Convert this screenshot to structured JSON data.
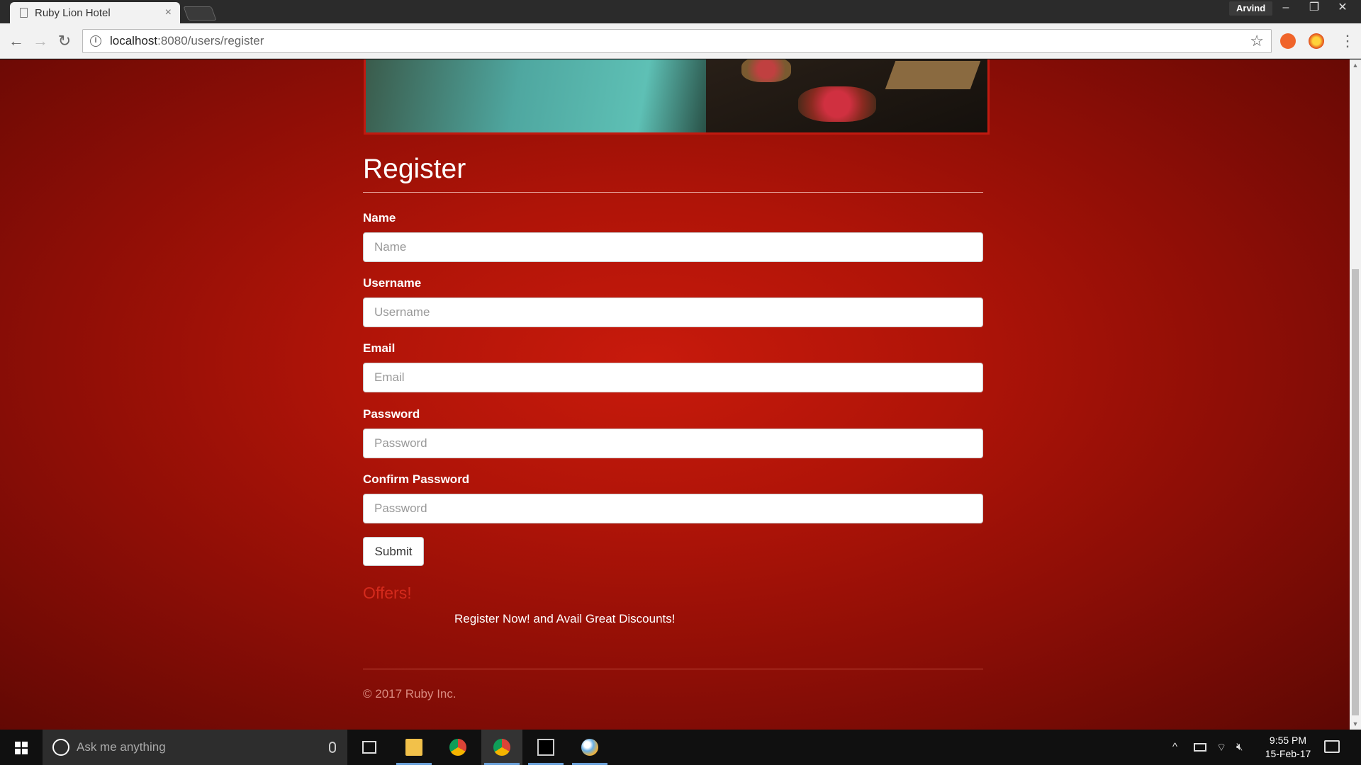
{
  "browser": {
    "tab_title": "Ruby Lion Hotel",
    "tab_close": "×",
    "profile_name": "Arvind",
    "url_host": "localhost",
    "url_rest": ":8080/users/register",
    "back": "←",
    "forward": "→",
    "reload": "↻",
    "star": "☆",
    "menu": "⋮",
    "minimize": "–",
    "restore": "❐",
    "close": "✕"
  },
  "page": {
    "title": "Register",
    "fields": [
      {
        "label": "Name",
        "placeholder": "Name"
      },
      {
        "label": "Username",
        "placeholder": "Username"
      },
      {
        "label": "Email",
        "placeholder": "Email"
      },
      {
        "label": "Password",
        "placeholder": "Password"
      },
      {
        "label": "Confirm Password",
        "placeholder": "Password"
      }
    ],
    "submit_label": "Submit",
    "offers_title": "Offers!",
    "offers_text": "Register Now! and Avail Great Discounts!",
    "copyright": "© 2017 Ruby Inc."
  },
  "taskbar": {
    "search_placeholder": "Ask me anything",
    "time": "9:55 PM",
    "date": "15-Feb-17",
    "apps": [
      "file-explorer-icon",
      "chrome-icon",
      "chrome-icon",
      "terminal-icon",
      "paint-icon"
    ]
  },
  "colors": {
    "background_red": "#b01408",
    "offers_red": "#d42a1c"
  }
}
